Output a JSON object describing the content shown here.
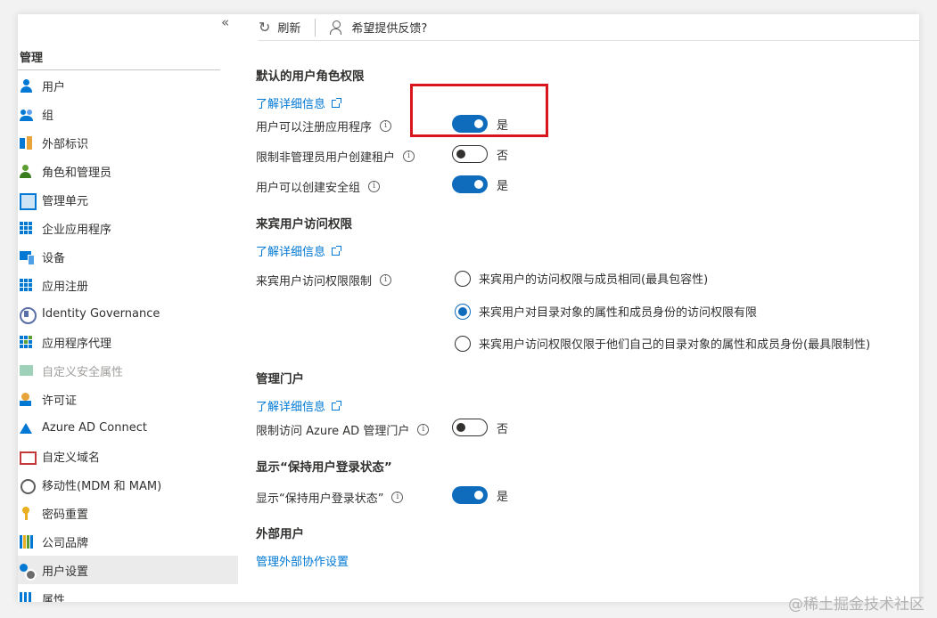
{
  "sidebar": {
    "collapse_glyph": "«",
    "section_title": "管理",
    "items": [
      {
        "label": "用户",
        "icon": "user-icon"
      },
      {
        "label": "组",
        "icon": "group-icon"
      },
      {
        "label": "外部标识",
        "icon": "external-identities-icon"
      },
      {
        "label": "角色和管理员",
        "icon": "roles-icon"
      },
      {
        "label": "管理单元",
        "icon": "admin-units-icon"
      },
      {
        "label": "企业应用程序",
        "icon": "enterprise-apps-icon"
      },
      {
        "label": "设备",
        "icon": "devices-icon"
      },
      {
        "label": "应用注册",
        "icon": "app-registrations-icon"
      },
      {
        "label": "Identity Governance",
        "icon": "identity-governance-icon"
      },
      {
        "label": "应用程序代理",
        "icon": "app-proxy-icon"
      },
      {
        "label": "自定义安全属性",
        "icon": "custom-security-attributes-icon"
      },
      {
        "label": "许可证",
        "icon": "licenses-icon"
      },
      {
        "label": "Azure AD Connect",
        "icon": "azure-ad-connect-icon"
      },
      {
        "label": "自定义域名",
        "icon": "custom-domain-icon"
      },
      {
        "label": "移动性(MDM 和 MAM)",
        "icon": "mobility-icon"
      },
      {
        "label": "密码重置",
        "icon": "password-reset-icon"
      },
      {
        "label": "公司品牌",
        "icon": "company-branding-icon"
      },
      {
        "label": "用户设置",
        "icon": "user-settings-icon"
      },
      {
        "label": "属性",
        "icon": "properties-icon"
      }
    ]
  },
  "toolbar": {
    "refresh_label": "刷新",
    "feedback_label": "希望提供反馈?"
  },
  "sections": {
    "default_role": {
      "title": "默认的用户角色权限",
      "learn_more": "了解详细信息",
      "register_apps": {
        "label": "用户可以注册应用程序",
        "state": "是",
        "on": true
      },
      "restrict_tenant": {
        "label": "限制非管理员用户创建租户",
        "state": "否",
        "on": false
      },
      "create_groups": {
        "label": "用户可以创建安全组",
        "state": "是",
        "on": true
      }
    },
    "guest_access": {
      "title": "来宾用户访问权限",
      "learn_more": "了解详细信息",
      "label": "来宾用户访问权限限制",
      "options": [
        "来宾用户的访问权限与成员相同(最具包容性)",
        "来宾用户对目录对象的属性和成员身份的访问权限有限",
        "来宾用户访问权限仅限于他们自己的目录对象的属性和成员身份(最具限制性)"
      ],
      "selected_index": 1
    },
    "admin_portal": {
      "title": "管理门户",
      "learn_more": "了解详细信息",
      "restrict_portal": {
        "label": "限制访问 Azure AD 管理门户",
        "state": "否",
        "on": false
      }
    },
    "stay_signed_in": {
      "title": "显示“保持用户登录状态”",
      "show_kmsi": {
        "label": "显示“保持用户登录状态”",
        "state": "是",
        "on": true
      }
    },
    "external_users": {
      "title": "外部用户",
      "manage_link": "管理外部协作设置"
    }
  },
  "watermark": "@稀土掘金技术社区",
  "colors": {
    "accent": "#0f6cbd",
    "highlight": "#d9161e",
    "link": "#0078d4"
  }
}
